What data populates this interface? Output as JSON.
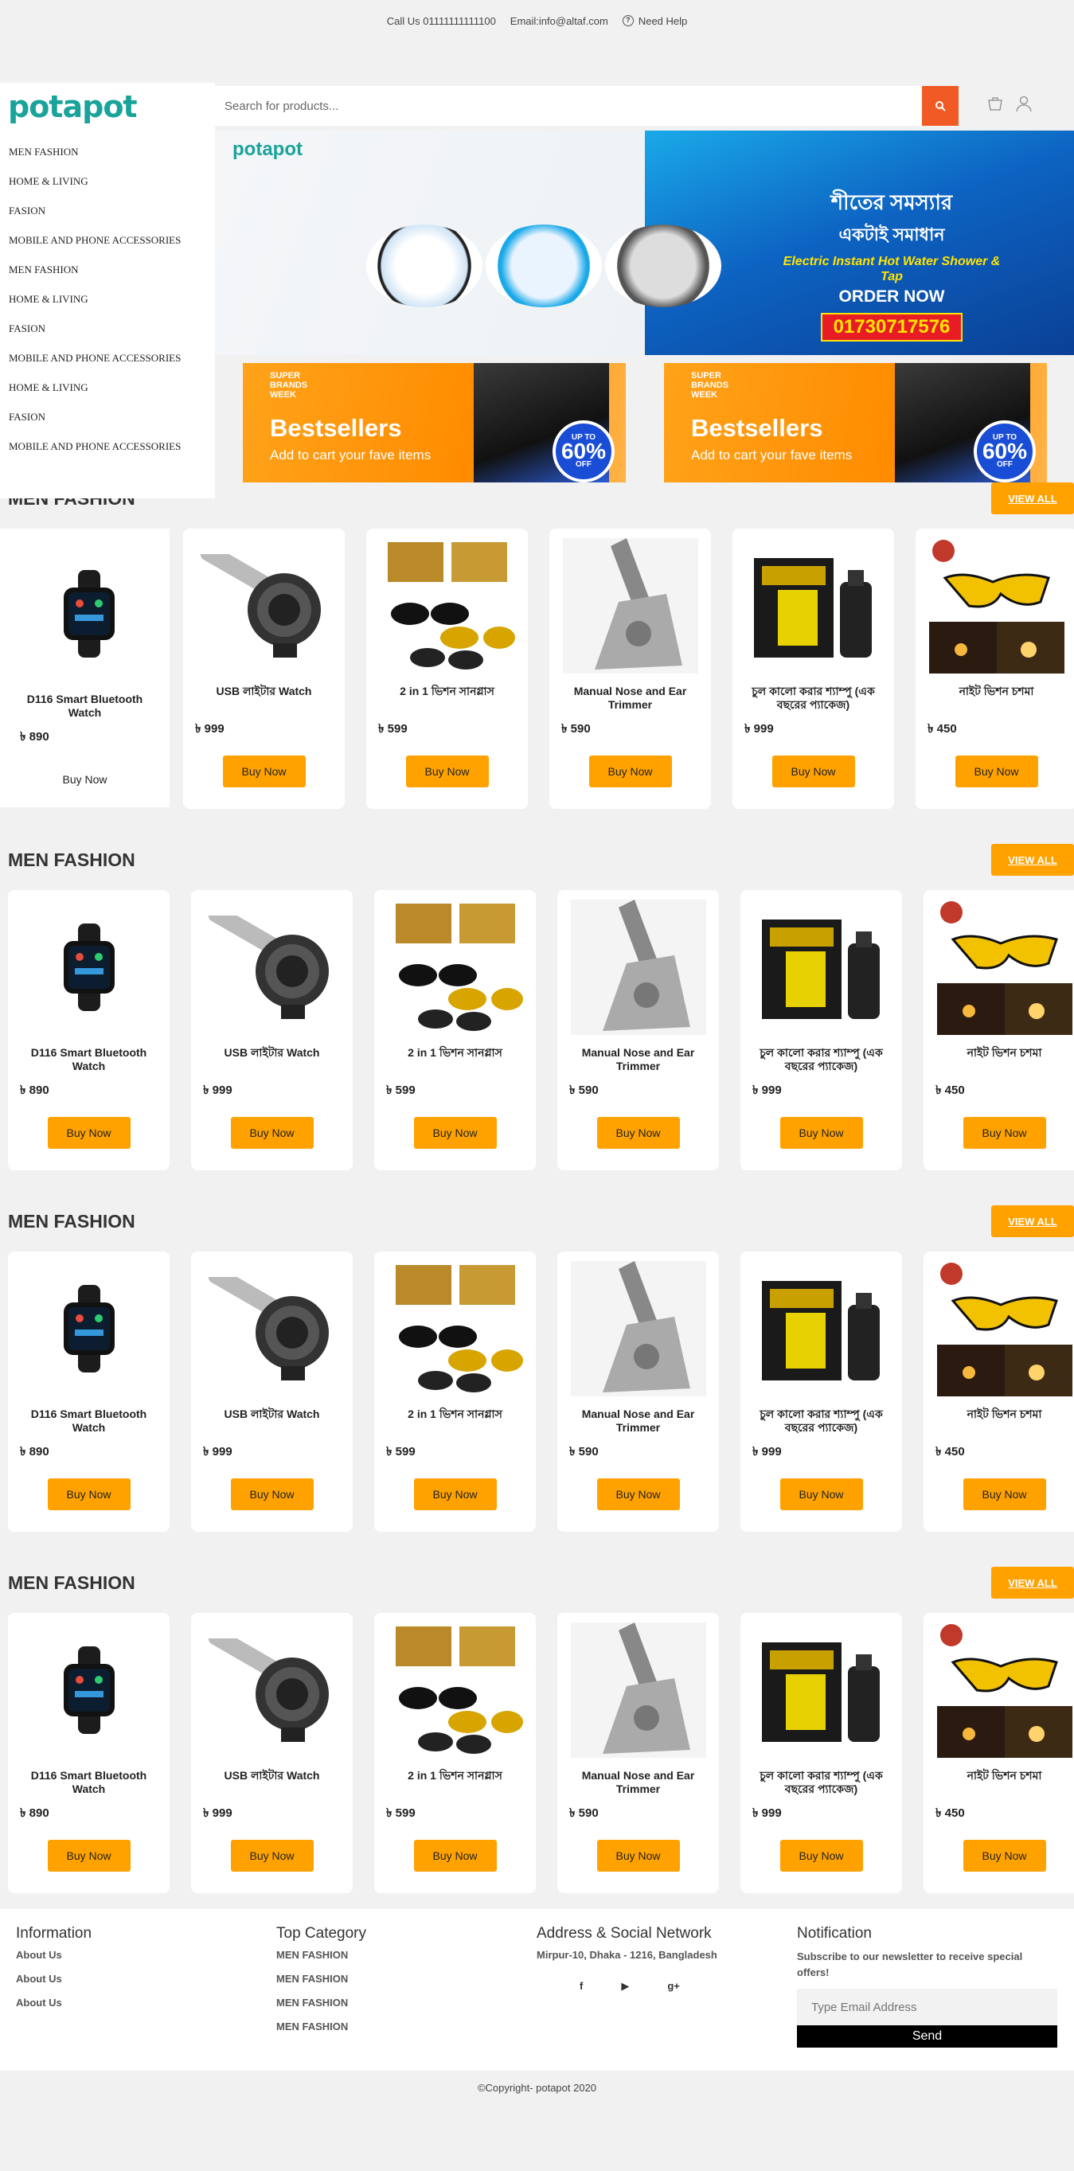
{
  "topbar": {
    "call": "Call Us 01111111111100",
    "email": "Email:info@altaf.com",
    "help": "Need Help"
  },
  "header": {
    "logo": "potapot",
    "search_placeholder": "Search for products..."
  },
  "sidebar": {
    "items": [
      "MEN FASHION",
      "HOME & LIVING",
      "FASION",
      "MOBILE AND PHONE ACCESSORIES",
      "MEN FASHION",
      "HOME & LIVING",
      "FASION",
      "MOBILE AND PHONE ACCESSORIES",
      "HOME & LIVING",
      "FASION",
      "MOBILE AND PHONE ACCESSORIES"
    ]
  },
  "banner": {
    "logo": "potapot",
    "line1": "শীতের সমস্যার",
    "line2": "একটাই সমাধান",
    "line3": "Electric Instant Hot Water Shower & Tap",
    "line4": "ORDER NOW",
    "phone": "01730717576"
  },
  "promos": [
    {
      "tag": "SUPER BRANDS WEEK",
      "title": "Bestsellers",
      "subtitle": "Add to cart your fave items",
      "badge_top": "UP TO",
      "badge": "60%",
      "badge_bottom": "OFF"
    },
    {
      "tag": "SUPER BRANDS WEEK",
      "title": "Bestsellers",
      "subtitle": "Add to cart your fave items",
      "badge_top": "UP TO",
      "badge": "60%",
      "badge_bottom": "OFF"
    }
  ],
  "sections": [
    {
      "title": "MEN FASHION",
      "view_all": "VIEW ALL"
    },
    {
      "title": "MEN FASHION",
      "view_all": "VIEW ALL"
    },
    {
      "title": "MEN FASHION",
      "view_all": "VIEW ALL"
    },
    {
      "title": "MEN FASHION",
      "view_all": "VIEW ALL"
    }
  ],
  "products": [
    {
      "name": "D116 Smart Bluetooth Watch",
      "price": "৳ 890",
      "icon": "smartwatch"
    },
    {
      "name": "USB লাইটার Watch",
      "price": "৳ 999",
      "icon": "lighter-watch"
    },
    {
      "name": "2 in 1 ভিশন সানগ্লাস",
      "price": "৳ 599",
      "icon": "sunglasses"
    },
    {
      "name": "Manual Nose and Ear Trimmer",
      "price": "৳ 590",
      "icon": "trimmer"
    },
    {
      "name": "চুল কালো করার শ্যাম্পু (এক বছরের প্যাকেজ)",
      "price": "৳ 999",
      "icon": "shampoo"
    },
    {
      "name": "নাইট ভিশন চশমা",
      "price": "৳ 450",
      "icon": "night-glasses"
    }
  ],
  "buy_label": "Buy Now",
  "footer": {
    "info_title": "Information",
    "info_links": [
      "About Us",
      "About Us",
      "About Us"
    ],
    "cat_title": "Top Category",
    "cat_links": [
      "MEN FASHION",
      "MEN FASHION",
      "MEN FASHION",
      "MEN FASHION"
    ],
    "addr_title": "Address & Social Network",
    "address": "Mirpur-10, Dhaka - 1216, Bangladesh",
    "social": [
      "f",
      "▶",
      "g+"
    ],
    "notif_title": "Notification",
    "notif_text": "Subscribe to our newsletter to receive special offers!",
    "email_placeholder": "Type Email Address",
    "send": "Send"
  },
  "copyright": "©Copyright- potapot 2020",
  "colors": {
    "accent": "#ffa200",
    "search_button": "#f15a24",
    "logo": "#1aa39a"
  }
}
